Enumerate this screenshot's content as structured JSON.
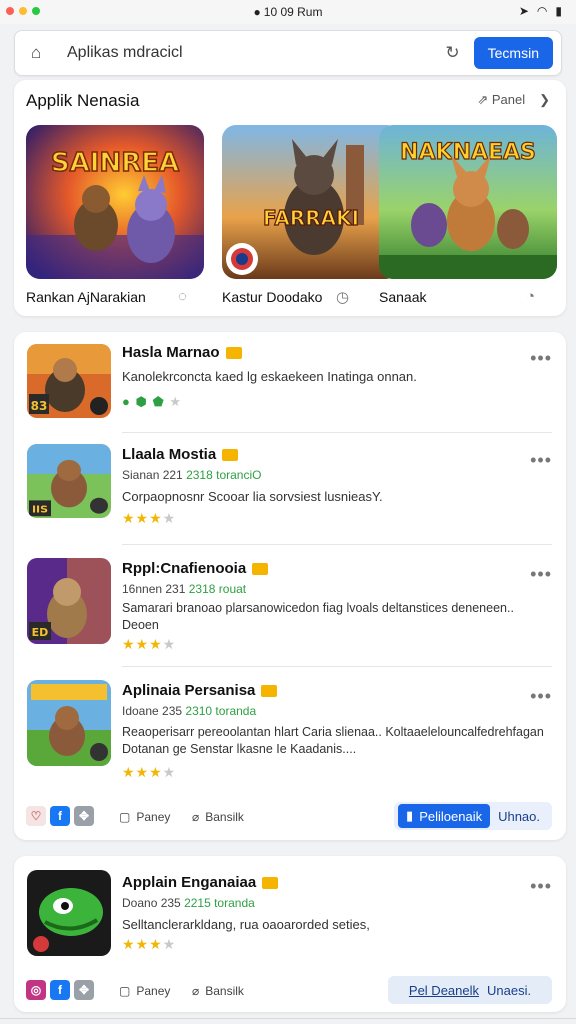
{
  "status": {
    "time": "10 09 Rum"
  },
  "colors": {
    "accent": "#1a66e8",
    "star": "#f2b705",
    "green": "#2ea043"
  },
  "search": {
    "text": "Aplikas mdracicl",
    "button": "Tecmsin"
  },
  "featured": {
    "title": "Applik Nenasia",
    "share_label": "Panel",
    "tiles": [
      {
        "caption": "Rankan AjNarakian",
        "art_title": "SAINREA"
      },
      {
        "caption": "Kastur Doodako",
        "art_title": "FARRAKI"
      },
      {
        "caption": "Sanaak",
        "art_title": "NAKNAEAS"
      }
    ]
  },
  "list": {
    "items": [
      {
        "title": "Hasla Marnao",
        "meta_a": "",
        "meta_b": "",
        "desc": "Kanolekrconcta kaed lg eskaekeen Inatinga onnan.",
        "rating": 2,
        "thumb_text": "83"
      },
      {
        "title": "Llaala Mostia",
        "meta_a": "Sianan 221",
        "meta_b": "2318 toranciO",
        "desc": "Corpaopnosnr Scooar lia sorvsiest lusnieasY.",
        "rating": 3,
        "thumb_text": "IIS"
      },
      {
        "title": "Rppl:Cnafienooia",
        "meta_a": "16nnen 231",
        "meta_b": "2318 rouat",
        "desc": "Samarari branoao plarsanowicedon fiag lvoals deltanstices deneneen.. Deoen",
        "rating": 3,
        "thumb_text": "ED"
      },
      {
        "title": "Aplinaia Persanisa",
        "meta_a": "Idoane 235",
        "meta_b": "2310 toranda",
        "desc": "Reaoperisarr pereoolantan hlart Caria slienaa.. Koltaaelelouncalfedrehfagan Dotanan ge Senstar lkasne Ie Kaadanis....",
        "rating": 3,
        "thumb_text": ""
      }
    ],
    "actions": {
      "share1": "Paney",
      "share2": "Bansilk",
      "cta_primary": "Peliloenaik",
      "cta_secondary": "Uhnao."
    }
  },
  "list2": {
    "item": {
      "title": "Applain Enganaiaa",
      "meta_a": "Doano 235",
      "meta_b": "2215 toranda",
      "desc": "Selltanclerarkldang, rua oaoarorded seties,",
      "rating": 3
    },
    "actions": {
      "share1": "Paney",
      "share2": "Bansilk",
      "cta_primary": "Pel Deanelk",
      "cta_secondary": "Unaesi."
    }
  }
}
